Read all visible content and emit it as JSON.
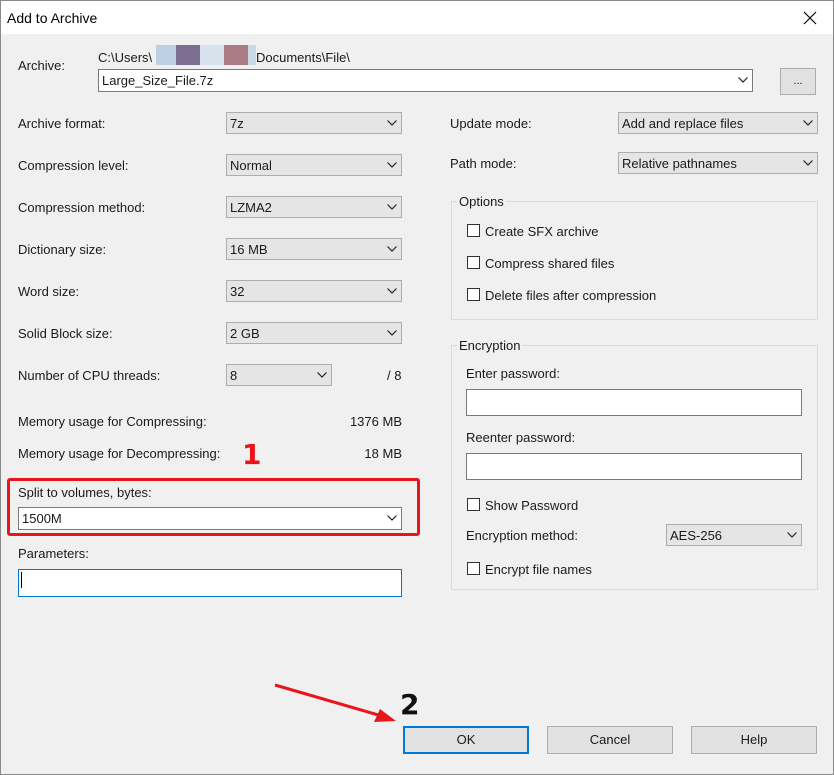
{
  "window": {
    "title": "Add to Archive",
    "close_glyph": "✕"
  },
  "archive": {
    "label": "Archive:",
    "path_prefix": "C:\\Users\\",
    "path_suffix": "Documents\\File\\",
    "value": "Large_Size_File.7z",
    "browse_label": "..."
  },
  "left": {
    "format": {
      "label": "Archive format:",
      "value": "7z"
    },
    "level": {
      "label": "Compression level:",
      "value": "Normal"
    },
    "method": {
      "label": "Compression method:",
      "value": "LZMA2"
    },
    "dict": {
      "label": "Dictionary size:",
      "value": "16 MB"
    },
    "word": {
      "label": "Word size:",
      "value": "32"
    },
    "solid": {
      "label": "Solid Block size:",
      "value": "2 GB"
    },
    "threads": {
      "label": "Number of CPU threads:",
      "value": "8",
      "max": "/ 8"
    },
    "mem_comp": {
      "label": "Memory usage for Compressing:",
      "value": "1376 MB"
    },
    "mem_decomp": {
      "label": "Memory usage for Decompressing:",
      "value": "18 MB"
    },
    "split": {
      "label": "Split to volumes, bytes:",
      "value": "1500M"
    },
    "params": {
      "label": "Parameters:",
      "value": ""
    }
  },
  "right": {
    "update": {
      "label": "Update mode:",
      "value": "Add and replace files"
    },
    "pathmode": {
      "label": "Path mode:",
      "value": "Relative pathnames"
    },
    "options": {
      "title": "Options",
      "sfx": "Create SFX archive",
      "shared": "Compress shared files",
      "delete": "Delete files after compression"
    },
    "encryption": {
      "title": "Encryption",
      "enter_label": "Enter password:",
      "reenter_label": "Reenter password:",
      "show": "Show Password",
      "method_label": "Encryption method:",
      "method_value": "AES-256",
      "names": "Encrypt file names"
    }
  },
  "buttons": {
    "ok": "OK",
    "cancel": "Cancel",
    "help": "Help"
  },
  "annotations": {
    "step1": "1",
    "step2": "2"
  },
  "colors": {
    "highlight_red": "#e8151b",
    "focus_blue": "#0078d7"
  }
}
